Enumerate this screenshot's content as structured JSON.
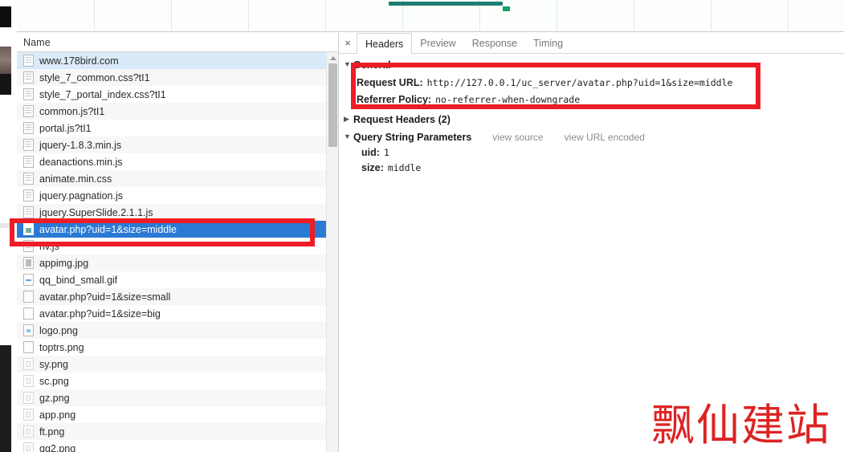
{
  "overview": {
    "bar_label": "network-timeline-bar",
    "bar_color": "#1c7e73",
    "marker_color": "#19a06a"
  },
  "list": {
    "column_header": "Name",
    "rows": [
      {
        "name": "www.178bird.com",
        "icon": "document-icon",
        "state": "first"
      },
      {
        "name": "style_7_common.css?tI1",
        "icon": "document-icon",
        "state": "alt"
      },
      {
        "name": "style_7_portal_index.css?tI1",
        "icon": "document-icon",
        "state": "normal"
      },
      {
        "name": "common.js?tI1",
        "icon": "document-icon",
        "state": "alt"
      },
      {
        "name": "portal.js?tI1",
        "icon": "document-icon",
        "state": "normal"
      },
      {
        "name": "jquery-1.8.3.min.js",
        "icon": "document-icon",
        "state": "alt"
      },
      {
        "name": "deanactions.min.js",
        "icon": "document-icon",
        "state": "normal"
      },
      {
        "name": "animate.min.css",
        "icon": "document-icon",
        "state": "alt"
      },
      {
        "name": "jquery.pagnation.js",
        "icon": "document-icon",
        "state": "normal"
      },
      {
        "name": "jquery.SuperSlide.2.1.1.js",
        "icon": "document-icon",
        "state": "alt"
      },
      {
        "name": "avatar.php?uid=1&size=middle",
        "icon": "image-preview-icon",
        "state": "selected"
      },
      {
        "name": "hv.js",
        "icon": "document-icon",
        "state": "normal"
      },
      {
        "name": "appimg.jpg",
        "icon": "image-icon",
        "state": "alt"
      },
      {
        "name": "qq_bind_small.gif",
        "icon": "dash-image-icon",
        "state": "normal"
      },
      {
        "name": "avatar.php?uid=1&size=small",
        "icon": "blank-image-icon",
        "state": "alt"
      },
      {
        "name": "avatar.php?uid=1&size=big",
        "icon": "blank-image-icon",
        "state": "normal"
      },
      {
        "name": "logo.png",
        "icon": "logo-image-icon",
        "state": "alt"
      },
      {
        "name": "toptrs.png",
        "icon": "blank-image-icon",
        "state": "normal"
      },
      {
        "name": "sy.png",
        "icon": "faint-image-icon",
        "state": "alt"
      },
      {
        "name": "sc.png",
        "icon": "faint-image-icon",
        "state": "normal"
      },
      {
        "name": "gz.png",
        "icon": "faint-image-icon",
        "state": "alt"
      },
      {
        "name": "app.png",
        "icon": "faint-image-icon",
        "state": "normal"
      },
      {
        "name": "ft.png",
        "icon": "faint-image-icon",
        "state": "alt"
      },
      {
        "name": "qq2.png",
        "icon": "faint-image-icon",
        "state": "normal"
      }
    ]
  },
  "detail": {
    "close_label": "×",
    "tabs": [
      {
        "label": "Headers",
        "active": true
      },
      {
        "label": "Preview",
        "active": false
      },
      {
        "label": "Response",
        "active": false
      },
      {
        "label": "Timing",
        "active": false
      }
    ],
    "general": {
      "section_title": "General",
      "request_url_key": "Request URL:",
      "request_url_value": "http://127.0.0.1/uc_server/avatar.php?uid=1&size=middle",
      "referrer_policy_key": "Referrer Policy:",
      "referrer_policy_value": "no-referrer-when-downgrade"
    },
    "request_headers_title": "Request Headers (2)",
    "query_string": {
      "section_title": "Query String Parameters",
      "view_source": "view source",
      "view_url_encoded": "view URL encoded",
      "params": [
        {
          "key": "uid:",
          "value": "1"
        },
        {
          "key": "size:",
          "value": "middle"
        }
      ]
    }
  },
  "annotations": {
    "box_color": "#ee1c25",
    "row_highlight_name": "red-highlight-selected-row",
    "url_highlight_name": "red-highlight-request-url"
  },
  "watermark": {
    "text": "飘仙建站",
    "color": "#dd2222"
  }
}
